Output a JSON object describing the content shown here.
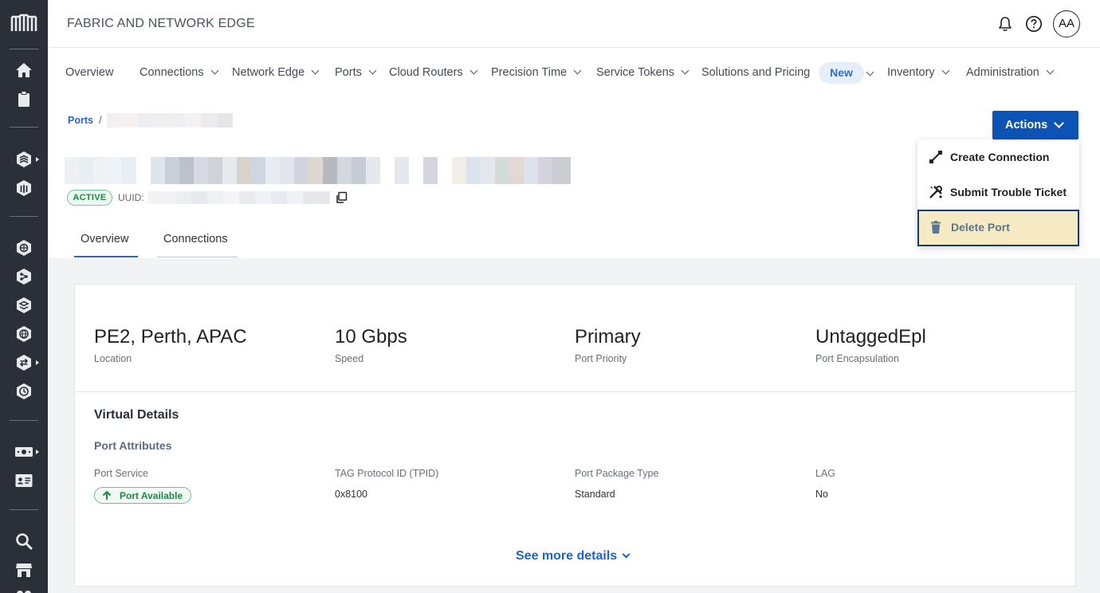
{
  "header": {
    "title": "FABRIC AND NETWORK EDGE",
    "avatar_initials": "AA"
  },
  "nav": {
    "items": [
      {
        "label": "Overview"
      },
      {
        "label": "Connections"
      },
      {
        "label": "Network Edge"
      },
      {
        "label": "Ports"
      },
      {
        "label": "Cloud Routers"
      },
      {
        "label": "Precision Time"
      },
      {
        "label": "Service Tokens"
      },
      {
        "label": "Solutions and Pricing"
      },
      {
        "label": "Inventory"
      },
      {
        "label": "Administration"
      }
    ],
    "new_badge": "New"
  },
  "breadcrumb": {
    "root": "Ports",
    "separator": "/"
  },
  "port": {
    "status": "ACTIVE",
    "uuid_label": "UUID:"
  },
  "tabs": [
    {
      "label": "Overview",
      "active": true
    },
    {
      "label": "Connections",
      "active": false
    }
  ],
  "actions": {
    "button_label": "Actions",
    "menu": [
      {
        "label": "Create Connection",
        "icon": "connection-icon"
      },
      {
        "label": "Submit Trouble Ticket",
        "icon": "tools-icon"
      },
      {
        "label": "Delete Port",
        "icon": "trash-icon",
        "highlighted": true
      }
    ]
  },
  "summary": [
    {
      "value": "PE2, Perth, APAC",
      "label": "Location"
    },
    {
      "value": "10 Gbps",
      "label": "Speed"
    },
    {
      "value": "Primary",
      "label": "Port Priority"
    },
    {
      "value": "UntaggedEpl",
      "label": "Port Encapsulation"
    }
  ],
  "virtual_details": {
    "title": "Virtual Details",
    "subtitle": "Port Attributes",
    "attributes": [
      {
        "label": "Port Service",
        "value": "Port Available"
      },
      {
        "label": "TAG Protocol ID (TPID)",
        "value": "0x8100"
      },
      {
        "label": "Port Package Type",
        "value": "Standard"
      },
      {
        "label": "LAG",
        "value": "No"
      }
    ],
    "see_more": "See more details"
  },
  "colors": {
    "rail": "#2b2f38",
    "primary": "#0b53b5",
    "link": "#2666c8",
    "active_green": "#1a8a47",
    "highlight": "#f5eac4"
  }
}
